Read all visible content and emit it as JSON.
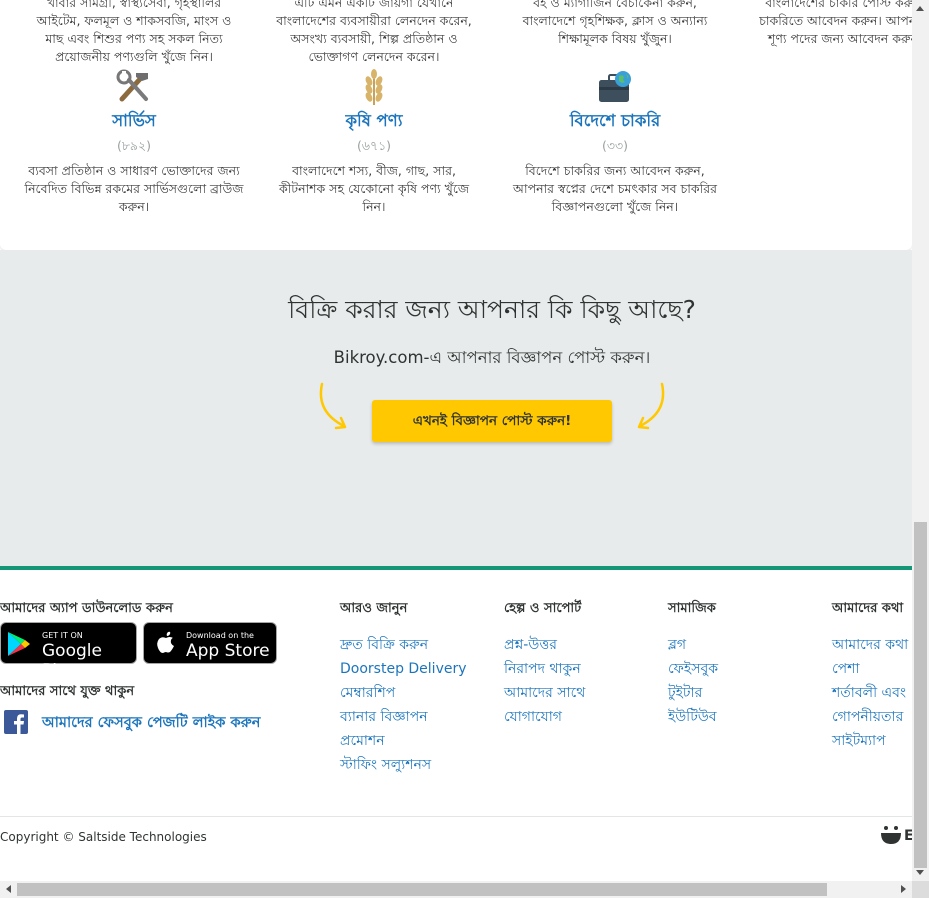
{
  "categories_top": [
    {
      "description_lines": [
        "খাবার সামগ্রী, স্বাস্থ্যসেবা, গৃহস্থালির",
        "আইটেম, ফলমূল ও শাকসবজি, মাংস ও",
        "মাছ এবং শিশুর পণ্য সহ সকল নিত্য",
        "প্রয়োজনীয় পণ্যগুলি খুঁজে নিন।"
      ]
    },
    {
      "description_lines": [
        "এটি এমন একটি জায়গা যেখানে",
        "বাংলাদেশের ব্যবসায়ীরা লেনদেন করেন,",
        "অসংখ্য ব্যবসায়ী, শিল্প প্রতিষ্ঠান ও",
        "ভোক্তাগণ লেনদেন করেন।"
      ]
    },
    {
      "description_lines": [
        "বই ও ম্যাগাজিন বেচাকেনা করুন,",
        "বাংলাদেশে গৃহশিক্ষক, ক্লাস ও অন্যান্য",
        "শিক্ষামূলক বিষয় খুঁজুন।"
      ]
    },
    {
      "description_lines": [
        "বাংলাদেশের চাকরি পোস্ট করুন",
        "চাকরিতে আবেদন করুন। আপনার",
        "শূণ্য পদের জন্য আবেদন করুন"
      ]
    }
  ],
  "categories": [
    {
      "icon": "tools-icon",
      "title": "সার্ভিস",
      "count": "(৮৯২)",
      "description_lines": [
        "ব্যবসা প্রতিষ্ঠান ও সাধারণ ভোক্তাদের জন্য",
        "নিবেদিত বিভিন্ন রকমের সার্ভিসগুলো ব্রাউজ",
        "করুন।"
      ]
    },
    {
      "icon": "wheat-icon",
      "title": "কৃষি পণ্য",
      "count": "(৬৭১)",
      "description_lines": [
        "বাংলাদেশে শস্য, বীজ, গাছ, সার,",
        "কীটনাশক সহ যেকোনো কৃষি পণ্য খুঁজে",
        "নিন।"
      ]
    },
    {
      "icon": "briefcase-globe-icon",
      "title": "বিদেশে চাকরি",
      "count": "(৩৩)",
      "description_lines": [
        "বিদেশে চাকরির জন্য আবেদন করুন,",
        "আপনার স্বপ্নের দেশে চমৎকার সব চাকরির",
        "বিজ্ঞাপনগুলো খুঁজে নিন।"
      ]
    }
  ],
  "sell": {
    "title": "বিক্রি করার জন্য আপনার কি কিছু আছে?",
    "subtitle": "Bikroy.com-এ আপনার বিজ্ঞাপন পোস্ট করুন।",
    "button_label": "এখনই বিজ্ঞাপন পোস্ট করুন!",
    "button_color": "#ffc800",
    "arrow_color": "#ffc800"
  },
  "footer": {
    "accent_color": "#149777",
    "app": {
      "heading": "আমাদের অ্যাপ ডাউনলোড করুন",
      "google_small": "GET IT ON",
      "google_big": "Google Play",
      "apple_small": "Download on the",
      "apple_big": "App Store"
    },
    "connect": {
      "heading": "আমাদের সাথে যুক্ত থাকুন",
      "facebook_link": "আমাদের ফেসবুক পেজটি লাইক করুন"
    },
    "columns": [
      {
        "heading": "আরও জানুন",
        "links": [
          "দ্রুত বিক্রি করুন",
          "Doorstep Delivery",
          "মেম্বারশিপ",
          "ব্যানার বিজ্ঞাপন",
          "প্রমোশন",
          "স্টাফিং সল্যুশনস"
        ]
      },
      {
        "heading": "হেল্প ও সাপোর্ট",
        "links": [
          "প্রশ্ন-উত্তর",
          "নিরাপদ থাকুন",
          "আমাদের সাথে",
          "যোগাযোগ"
        ]
      },
      {
        "heading": "সামাজিক",
        "links": [
          "ব্লগ",
          "ফেইসবুক",
          "টুইটার",
          "ইউটিউব"
        ]
      },
      {
        "heading": "আমাদের কথা",
        "links": [
          "আমাদের কথা",
          "পেশা",
          "শর্তাবলী এবং",
          "গোপনীয়তার",
          "সাইটম্যাপ"
        ]
      }
    ],
    "copyright": "Copyright © Saltside Technologies",
    "logo_letter": "E"
  }
}
